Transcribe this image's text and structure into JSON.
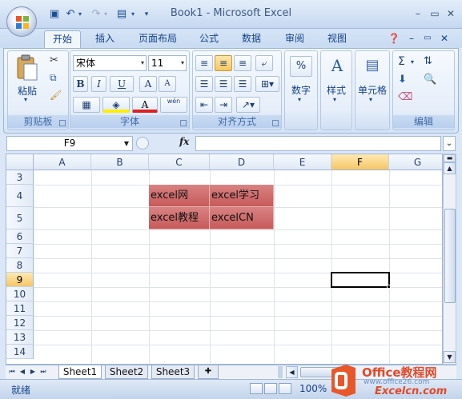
{
  "window": {
    "title": "Book1 - Microsoft Excel"
  },
  "tabs": [
    "开始",
    "插入",
    "页面布局",
    "公式",
    "数据",
    "审阅",
    "视图"
  ],
  "ribbon": {
    "clipboard": {
      "label": "剪贴板",
      "paste": "粘贴"
    },
    "font": {
      "label": "字体",
      "name": "宋体",
      "size": "11",
      "bold": "B",
      "italic": "I",
      "underline": "U",
      "grow": "A",
      "shrink": "A",
      "color": "A",
      "phonetic": "wén"
    },
    "alignment": {
      "label": "对齐方式"
    },
    "number": {
      "label": "数字",
      "symbol": "%"
    },
    "styles": {
      "label": "样式"
    },
    "cells": {
      "label": "单元格"
    },
    "editing": {
      "label": "编辑",
      "sum": "Σ"
    }
  },
  "formula_bar": {
    "name_box": "F9",
    "fx": "fx",
    "formula": ""
  },
  "grid": {
    "columns": [
      "A",
      "B",
      "C",
      "D",
      "E",
      "F",
      "G"
    ],
    "rows": [
      "3",
      "4",
      "5",
      "6",
      "7",
      "8",
      "9",
      "10",
      "11",
      "12",
      "13",
      "14"
    ],
    "active_cell": "F9",
    "cells": {
      "C4": "excel网",
      "D4": "excel学习",
      "C5": "excel教程",
      "D5": "excelCN"
    },
    "fill_color": "#d06c6c"
  },
  "sheets": [
    "Sheet1",
    "Sheet2",
    "Sheet3"
  ],
  "status": {
    "text": "就绪",
    "zoom": "100%"
  },
  "watermark": {
    "line1": "Office教程网",
    "line2": "www.office26.com",
    "line3": "Excelcn.com"
  }
}
